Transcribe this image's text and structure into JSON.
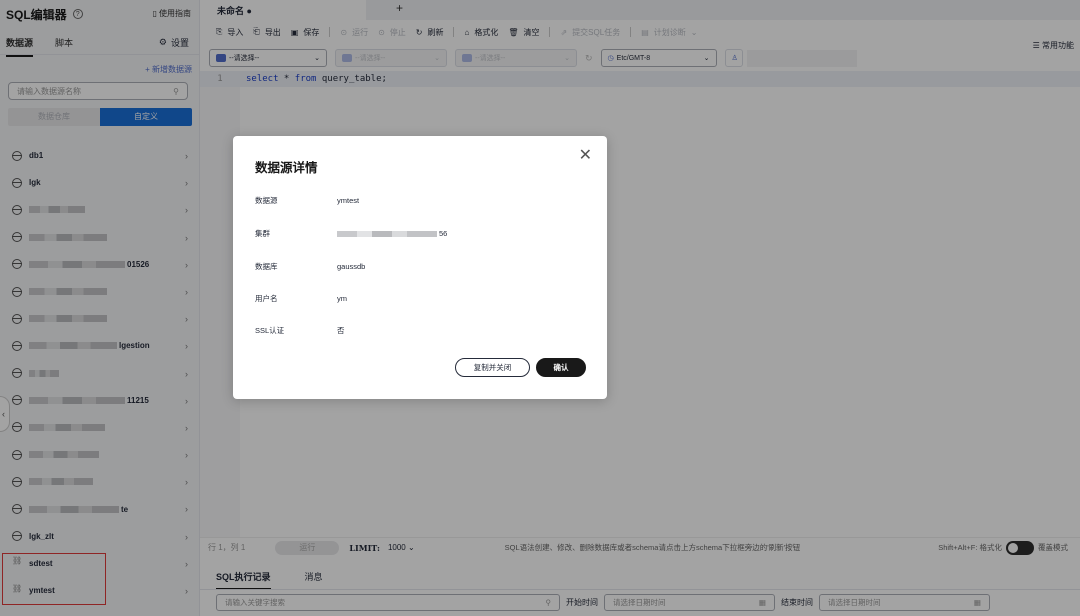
{
  "sidebar": {
    "title": "SQL编辑器",
    "help_icon": "?",
    "guide_label": "使用指南",
    "tabs": [
      "数据源",
      "脚本"
    ],
    "settings_label": "设置",
    "new_datasource": "+ 新增数据源",
    "search_placeholder": "请输入数据源名称",
    "segments": [
      "数据仓库",
      "自定义"
    ],
    "items": [
      {
        "name": "db1",
        "icon": "database-icon"
      },
      {
        "name": "lgk",
        "icon": "database-icon"
      },
      {
        "name": "",
        "icon": "database-icon"
      },
      {
        "name": "",
        "icon": "database-icon"
      },
      {
        "name": "01526",
        "icon": "database-icon"
      },
      {
        "name": "",
        "icon": "database-icon"
      },
      {
        "name": "",
        "icon": "database-icon"
      },
      {
        "name": "lgestion",
        "icon": "database-icon"
      },
      {
        "name": "",
        "icon": "database-icon"
      },
      {
        "name": "11215",
        "icon": "database-icon"
      },
      {
        "name": "",
        "icon": "database-icon"
      },
      {
        "name": "",
        "icon": "database-icon"
      },
      {
        "name": "",
        "icon": "database-icon"
      },
      {
        "name": "te",
        "icon": "database-icon"
      },
      {
        "name": "lgk_zlt",
        "icon": "database-icon"
      },
      {
        "name": "sdtest",
        "icon": "link-icon"
      },
      {
        "name": "ymtest",
        "icon": "link-icon"
      }
    ]
  },
  "editor": {
    "tab_title": "未命名 ●",
    "add_tab": "+",
    "toolbar": {
      "import": "导入",
      "export": "导出",
      "save": "保存",
      "run": "运行",
      "stop": "停止",
      "refresh": "刷新",
      "format": "格式化",
      "clear": "清空",
      "submit": "提交SQL任务",
      "diagnose": "计划诊断"
    },
    "common_functions": "常用功能",
    "selectors": {
      "datasource": "--请选择--",
      "database": "--请选择--",
      "schema": "--请选择--",
      "timezone": "Etc/GMT-8"
    },
    "line_number": "1",
    "code": {
      "kw1": "select",
      "mid": " * ",
      "kw2": "from",
      "rest": " query_table;"
    },
    "status": {
      "position": "行 1，列 1",
      "run": "运行",
      "limit_label": "LIMIT:",
      "limit_value": "1000",
      "hint": "SQL语法创建、修改、删除数据库或者schema请点击上方schema下拉框旁边的'刷新'按钮",
      "shortcut": "Shift+Alt+F: 格式化",
      "overwrite": "覆盖模式"
    },
    "result_tabs": [
      "SQL执行记录",
      "消息"
    ],
    "filter": {
      "keyword_placeholder": "请输入关键字搜索",
      "start_label": "开始时间",
      "start_placeholder": "请选择日期时间",
      "end_label": "结束时间",
      "end_placeholder": "请选择日期时间"
    }
  },
  "modal": {
    "title": "数据源详情",
    "rows": [
      {
        "label": "数据源",
        "value": "ymtest"
      },
      {
        "label": "集群",
        "value": "56"
      },
      {
        "label": "数据库",
        "value": "gaussdb"
      },
      {
        "label": "用户名",
        "value": "ym"
      },
      {
        "label": "SSL认证",
        "value": "否"
      }
    ],
    "copy_close": "复制并关闭",
    "confirm": "确认"
  }
}
